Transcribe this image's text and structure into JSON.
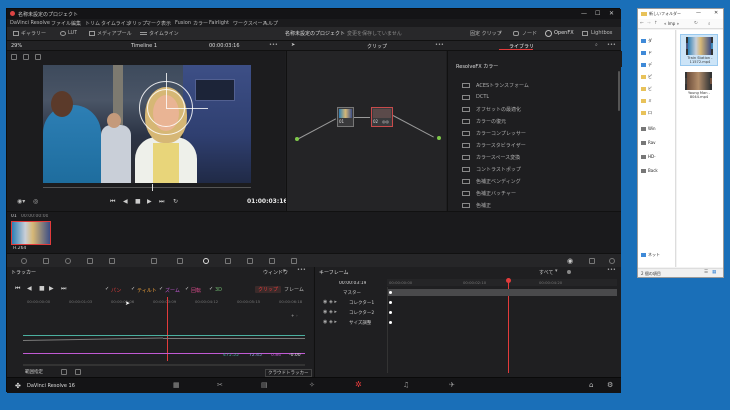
{
  "window": {
    "title": "名称未設定のプロジェクト",
    "controls": [
      "—",
      "☐",
      "✕"
    ]
  },
  "menu": [
    "DaVinci Resolve",
    "ファイル",
    "編集",
    "トリム",
    "タイムライン",
    "クリップ",
    "マーク",
    "表示",
    "Fusion",
    "カラー",
    "Fairlight",
    "ワークスペース",
    "ヘルプ"
  ],
  "modebar": {
    "gallery": "ギャラリー",
    "lut": "LUT",
    "mediapool": "メディアプール",
    "timeline": "タイムライン",
    "project_title": "名称未設定のプロジェクト",
    "project_status": "変更を保存していません",
    "clip_mode": "固定 クリップ",
    "nodes": "ノード",
    "openfx": "OpenFX",
    "lightbox": "Lightbox"
  },
  "subbar": {
    "zoom": "29%",
    "timeline_name": "Timeline 1",
    "timecode": "00:00:03:16",
    "clip_label": "クリップ",
    "library_tab": "ライブラリ"
  },
  "viewer": {
    "timecode": "01:00:03:16"
  },
  "nodes": {
    "node1_label": "01",
    "node2_label": "02"
  },
  "library": {
    "header": "ResolveFX カラー",
    "items": [
      "ACESトランスフォーム",
      "DCTL",
      "オフセットの最適化",
      "カラーの復元",
      "カラーコンプレッサー",
      "カラースタビライザー",
      "カラースペース変換",
      "コントラストポップ",
      "色補正ベンディング",
      "色補正バッチャー",
      "色補正"
    ]
  },
  "thumbs": {
    "clip_index": "01",
    "clip_time": "00:00:00:00",
    "clip_codec": "H.264"
  },
  "tracker": {
    "title": "トラッカー",
    "window_label": "ウィンドウ",
    "options": [
      "パン",
      "ティルト",
      "ズーム",
      "回転",
      "3D"
    ],
    "clip_btn": "クリップ",
    "frame_btn": "フレーム",
    "ruler": [
      "00:00:00:00",
      "00:00:01:03",
      "00:00:02:06",
      "00:00:03:09",
      "00:00:04:12",
      "00:00:05:15",
      "00:00:06:18"
    ],
    "readouts": [
      "475.55",
      "72.45",
      "0.84",
      "-0.00"
    ],
    "bottom_label": "範囲指定",
    "bottom_dropdown": "クラウドトラッカー"
  },
  "keyframe": {
    "title": "キーフレーム",
    "timecode": "00:00:03:19",
    "mode": "すべて",
    "ruler": [
      "00:00:00:00",
      "00:00:02:10",
      "00:00:04:20"
    ],
    "rows": [
      "マスター",
      "コレクター1",
      "コレクター2",
      "サイズ調整"
    ]
  },
  "footer": {
    "app_name": "DaVinci Resolve 16"
  },
  "explorer": {
    "title": "新しいフォルダー",
    "path": "«  Imp  »",
    "nav_items": [
      "ダ",
      "ド",
      "デ",
      "ピ",
      "ビ",
      "ミ",
      "ロ",
      "Win",
      "Rav",
      "HD-",
      "Back",
      "ネット"
    ],
    "files": [
      {
        "name": "Train Station - 11572.mp4"
      },
      {
        "name": "Young Man - 8044.mp4"
      }
    ],
    "status": "2 個の項目"
  },
  "colors": {
    "accent_red": "#e23b3b",
    "accent_orange": "#f0a13a",
    "panel_bg": "#1e1e20",
    "desktop": "#1a6fb8"
  }
}
